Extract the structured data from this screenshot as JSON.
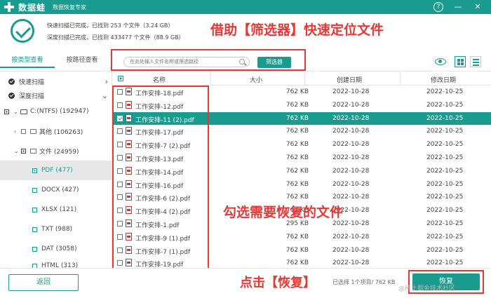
{
  "titlebar": {
    "app_name": "数据蛙",
    "app_subtitle": "数据恢复专家",
    "help_icon": "help-icon",
    "minimize_icon": "minimize-icon",
    "close_icon": "close-icon"
  },
  "summary": {
    "quick_scan_line": "快速扫描已完成，已找到  253  个文件（3.24 GB）",
    "deep_scan_line": "深度扫描已完成，已找到  433477  个文件（88.9 GB）"
  },
  "annotations": {
    "filter_hint": "借助【筛选器】快速定位文件",
    "select_hint": "勾选需要恢复的文件",
    "recover_hint": "点击【恢复】"
  },
  "toolbar": {
    "tab_type": "按类型查看",
    "tab_path": "按路径查看",
    "search_placeholder": "在此处输入文件名称或筛选路径",
    "filter_label": "筛选器"
  },
  "sidebar": {
    "quick_scan": "快速扫描",
    "deep_scan": "深度扫描",
    "drive": "C:(NTFS) (192947)",
    "other": "其他 (106263)",
    "files": "文件 (24959)",
    "pdf": "PDF (477)",
    "docx": "DOCX (427)",
    "xlsx": "XLSX (121)",
    "txt": "TXT (988)",
    "dat": "DAT (3058)",
    "html": "HTML (313)"
  },
  "table": {
    "headers": {
      "name": "名称",
      "size": "大小",
      "created": "创建日期",
      "modified": "修改日期"
    },
    "rows": [
      {
        "name": "工作安排-18.pdf",
        "size": "762 KB",
        "created": "2022-10-28",
        "modified": "2022-10-25"
      },
      {
        "name": "工作安排-12.pdf",
        "size": "762 KB",
        "created": "2022-10-28",
        "modified": "2022-10-25"
      },
      {
        "name": "工作安排-11 (2).pdf",
        "size": "762 KB",
        "created": "2022-10-28",
        "modified": "2022-10-25"
      },
      {
        "name": "工作安排-17.pdf",
        "size": "762 KB",
        "created": "2022-10-28",
        "modified": "2022-10-25"
      },
      {
        "name": "工作安排-7 (2).pdf",
        "size": "762 KB",
        "created": "2022-10-28",
        "modified": "2022-10-25"
      },
      {
        "name": "工作安排-13.pdf",
        "size": "762 KB",
        "created": "2022-10-28",
        "modified": "2022-10-25"
      },
      {
        "name": "工作安排-14.pdf",
        "size": "762 KB",
        "created": "2022-10-28",
        "modified": "2022-10-25"
      },
      {
        "name": "工作安排-16.pdf",
        "size": "762 KB",
        "created": "2022-10-28",
        "modified": "2022-10-25"
      },
      {
        "name": "工作安排-6 (2).pdf",
        "size": "762 KB",
        "created": "2022-10-28",
        "modified": "2022-10-25"
      },
      {
        "name": "工作安排-4 (2).pdf",
        "size": "762 KB",
        "created": "2022-10-28",
        "modified": "2022-10-25"
      },
      {
        "name": "工作安排-1.pdf",
        "size": "295 KB",
        "created": "2022-10-28",
        "modified": "2022-10-25"
      },
      {
        "name": "工作安排-9 (1).pdf",
        "size": "762 KB",
        "created": "2022-10-28",
        "modified": "2022-10-25"
      },
      {
        "name": "工作安排-7 (1).pdf",
        "size": "762 KB",
        "created": "2022-10-28",
        "modified": "2022-10-25"
      },
      {
        "name": "工作安排-19.pdf",
        "size": "762 KB",
        "created": "2022-10-28",
        "modified": "2022-10-25"
      }
    ]
  },
  "bottom": {
    "back_label": "返回",
    "status": "已选择 1个项目/ 762 KB",
    "recover_label": "恢复",
    "watermark": "@稀土掘金技术社区"
  },
  "colors": {
    "accent": "#1a9b8f",
    "annotation": "#e53935"
  }
}
